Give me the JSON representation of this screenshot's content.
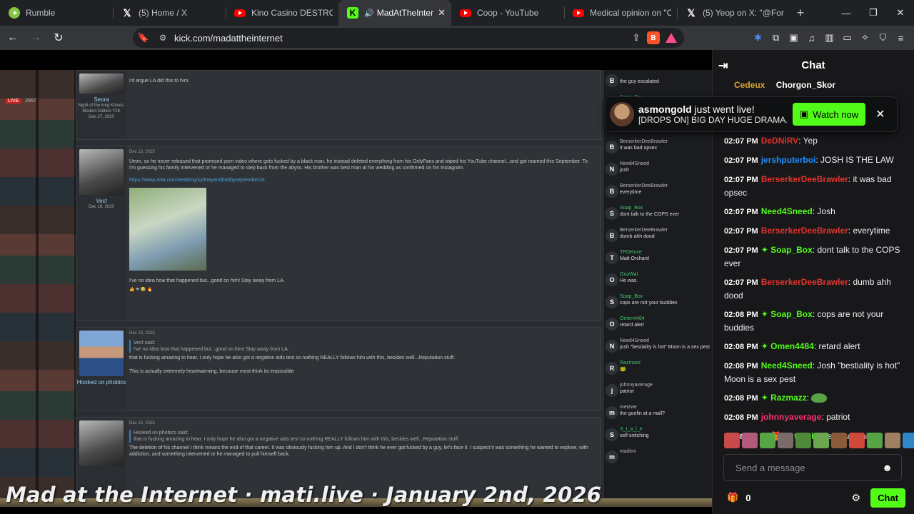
{
  "browser": {
    "tabs": [
      {
        "title": "Rumble",
        "icon": "rumble-icon"
      },
      {
        "title": "(5) Home / X",
        "icon": "x-icon"
      },
      {
        "title": "Kino Casino DESTROYS DS",
        "icon": "youtube-icon"
      },
      {
        "title": "MadAtTheInternet",
        "icon": "kick-icon",
        "active": true
      },
      {
        "title": "Coop - YouTube",
        "icon": "youtube-icon"
      },
      {
        "title": "Medical opinion on \"Cyrax",
        "icon": "youtube-icon"
      },
      {
        "title": "(5) Yeop on X: \"@Forsaken",
        "icon": "x-icon"
      }
    ],
    "url": "kick.com/madattheinternet"
  },
  "stream": {
    "live_label": "LIVE",
    "viewer_count": "2957",
    "caption": "Mad at the Internet · mati.live · January 2nd, 2026",
    "forum": {
      "posts": [
        {
          "user": "Seora",
          "title": "Night of the long Knives: Modern Edition Y2K",
          "joined": "Dec 27, 2020",
          "text": "I'd argue LA did this to him."
        },
        {
          "user": "Vect",
          "date": "Dec 13, 2025",
          "joined": "Dec 16, 2020",
          "text": "Umm, so he never released that promised porn video where gets fucked by a black man, he instead deleted everything from his OnlyFans and wiped his YouTube channel...and got married this September. To I'm guessing his family intervened or he managed to step back from the abyss. His brother was best man at his wedding as confirmed on his Instagram.",
          "link": "https://www.zola.com/wedding/sydneyandbobbyseptember20",
          "after": "I've no idea how that happened but...good on him! Stay away from LA."
        },
        {
          "user": "Hooked on phobics",
          "date": "Dec 13, 2025",
          "quote_by": "Vect said:",
          "quote": "I've no idea how that happened but...good on him! Stay away from LA.",
          "text": "that is fucking amazing to hear. I only hope he also got a negative aids test so nothing REALLY follows him with this, besides well...Reputation stuff.",
          "text2": "This is actually extremely heartwarming, because most think its impossible"
        },
        {
          "user": "Vect",
          "date": "Dec 13, 2025",
          "quote_by": "Hooked on phobics said:",
          "quote": "that is fucking amazing to hear. I only hope he also got a negative aids test so nothing REALLY follows him with this, besides well...Reputation stuff.",
          "text": "The deletion of his channel I think means the end of that career. It was obviously fucking him up. And I don't think he ever got fucked by a guy, let's face it. I suspect it was something he wanted to explore, with addiction, and something intervened or he managed to pull himself back."
        }
      ]
    },
    "overlay_chat": [
      {
        "badge": "B",
        "name": "",
        "msg": "the guy escalated"
      },
      {
        "badge": "S",
        "name": "Soap_Box",
        "msg": "SYBIL SYBIL SYBIL",
        "green": true
      },
      {
        "badge": "j",
        "name": "",
        "msg": "JOSH IS THE LAW"
      },
      {
        "badge": "B",
        "name": "BerserkerDeeBrawler",
        "msg": "it was bad opsec"
      },
      {
        "badge": "N",
        "name": "Need4Sneed",
        "msg": "josh"
      },
      {
        "badge": "B",
        "name": "BerserkerDeeBrawler",
        "msg": "everytime"
      },
      {
        "badge": "S",
        "name": "Soap_Box",
        "msg": "dont talk to the COPS ever",
        "green": true
      },
      {
        "badge": "B",
        "name": "BerserkerDeeBrawler",
        "msg": "dumb ahh dood"
      },
      {
        "badge": "T",
        "name": "TPDeluxe",
        "msg": "Matt Orchard",
        "green": true
      },
      {
        "badge": "O",
        "name": "OnaWal",
        "msg": "He was.",
        "green": true
      },
      {
        "badge": "S",
        "name": "Soap_Box",
        "msg": "cops are not your buddies",
        "green": true
      },
      {
        "badge": "O",
        "name": "Omen4484",
        "msg": "retard alert",
        "green": true
      },
      {
        "badge": "N",
        "name": "Need4Sneed",
        "msg": "josh \"bestiality is hot\" Moon is a sex pest"
      },
      {
        "badge": "R",
        "name": "Razmazz",
        "msg": "🐸",
        "green": true
      },
      {
        "badge": "j",
        "name": "johnnyaverage",
        "msg": "patriot"
      },
      {
        "badge": "m",
        "name": "meizwe",
        "msg": "the goofin at a mall?"
      },
      {
        "badge": "S",
        "name": "S_t_a_l_e",
        "msg": "self snitching",
        "green": true
      },
      {
        "badge": "m",
        "name": "madimi",
        "msg": ""
      }
    ]
  },
  "chat": {
    "title": "Chat",
    "pinned": {
      "name": "Cedeux",
      "name2": "Chorgon_Skor",
      "count": "5"
    },
    "messages": [
      {
        "time": "02:07 PM",
        "user": "DeDNiRV",
        "color": "red",
        "text": ": Yep"
      },
      {
        "time": "02:07 PM",
        "user": "jershputerboi",
        "color": "blue",
        "text": ": JOSH IS THE LAW"
      },
      {
        "time": "02:07 PM",
        "user": "BerserkerDeeBrawler",
        "color": "red",
        "text": ": it was bad opsec"
      },
      {
        "time": "02:07 PM",
        "user": "Need4Sneed",
        "color": "green",
        "text": ": Josh"
      },
      {
        "time": "02:07 PM",
        "user": "BerserkerDeeBrawler",
        "color": "red",
        "text": ": everytime"
      },
      {
        "time": "02:07 PM",
        "user": "Soap_Box",
        "color": "green",
        "badge": "✦",
        "text": ": dont talk to the COPS ever"
      },
      {
        "time": "02:07 PM",
        "user": "BerserkerDeeBrawler",
        "color": "red",
        "text": ": dumb ahh dood"
      },
      {
        "time": "02:08 PM",
        "user": "Soap_Box",
        "color": "green",
        "badge": "✦",
        "text": ": cops are not your buddies"
      },
      {
        "time": "02:08 PM",
        "user": "Omen4484",
        "color": "green",
        "badge": "✦",
        "text": ": retard alert"
      },
      {
        "time": "02:08 PM",
        "user": "Need4Sneed",
        "color": "green",
        "text": ": Josh \"bestiality is hot\" Moon is a sex pest"
      },
      {
        "time": "02:08 PM",
        "user": "Razmazz",
        "color": "green",
        "badge": "✦",
        "text": ": ",
        "emote": true
      },
      {
        "time": "02:08 PM",
        "user": "johnnyaverage",
        "color": "pink",
        "text": ": patriot"
      },
      {
        "time": "02:08 PM",
        "user": "S_t_a_l_e",
        "color": "green",
        "badge": "✦",
        "gift": "🎁",
        "text": ": self snitching"
      }
    ],
    "input_placeholder": "Send a message",
    "points": "0",
    "send_label": "Chat"
  },
  "notification": {
    "user": "asmongold",
    "action": " just went live!",
    "subtitle": "[DROPS ON] BIG DAY HUGE DRAMA...",
    "button": "Watch now"
  }
}
